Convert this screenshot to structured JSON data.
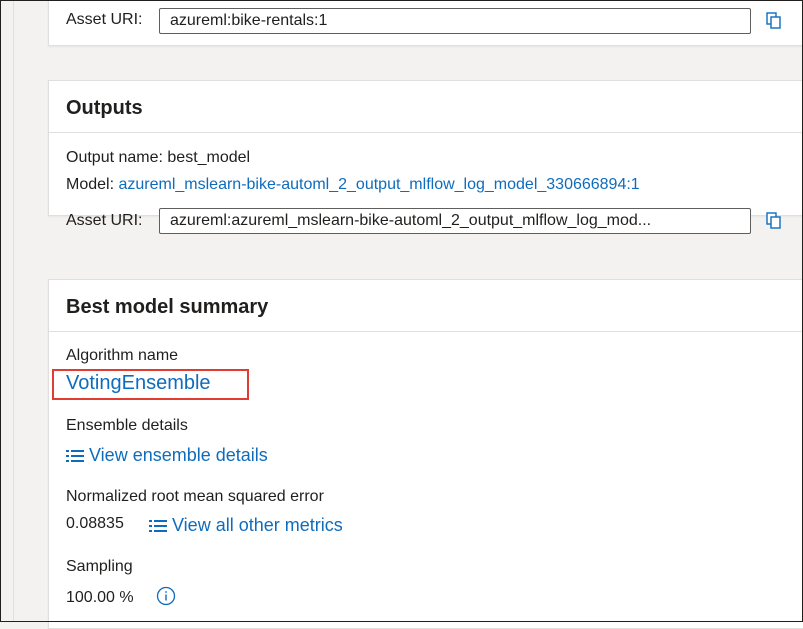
{
  "input_asset": {
    "asset_uri_label": "Asset URI:",
    "asset_uri_value": "azureml:bike-rentals:1"
  },
  "outputs": {
    "title": "Outputs",
    "output_name": "Output name: best_model",
    "model_label": "Model:",
    "model_link": "azureml_mslearn-bike-automl_2_output_mlflow_log_model_330666894:1",
    "asset_uri_label": "Asset URI:",
    "asset_uri_value": "azureml:azureml_mslearn-bike-automl_2_output_mlflow_log_mod..."
  },
  "summary": {
    "title": "Best model summary",
    "algorithm_label": "Algorithm name",
    "algorithm_value": "VotingEnsemble",
    "ensemble_label": "Ensemble details",
    "ensemble_link": "View ensemble details",
    "metric_label": "Normalized root mean squared error",
    "metric_value": "0.08835",
    "metrics_link": "View all other metrics",
    "sampling_label": "Sampling",
    "sampling_value": "100.00 %"
  },
  "colors": {
    "link": "#0f6cbd",
    "highlight": "#e03c31"
  },
  "icons": [
    "copy-icon",
    "list-icon",
    "info-icon"
  ]
}
